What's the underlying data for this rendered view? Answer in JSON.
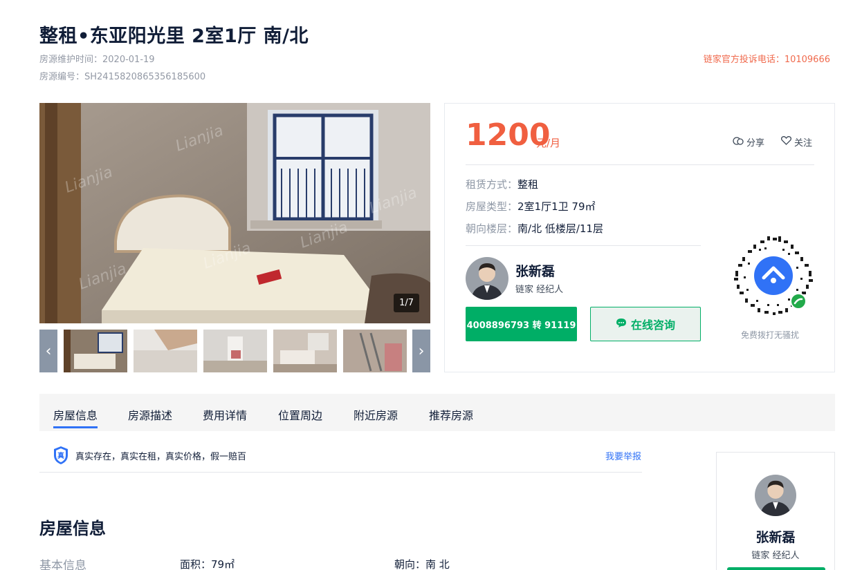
{
  "header": {
    "title": "整租•东亚阳光里 2室1厅 南/北",
    "maintain_time": "房源维护时间：2020-01-19",
    "listing_id": "房源编号：SH2415820865356185600",
    "complaint_hotline": "链家官方投诉电话：10109666"
  },
  "gallery": {
    "counter": "1/7",
    "watermark": "Lianjia"
  },
  "price_panel": {
    "price": "1200",
    "unit": "元/月",
    "share_label": "分享",
    "follow_label": "关注",
    "rows": [
      {
        "label": "租赁方式：",
        "value": "整租"
      },
      {
        "label": "房屋类型：",
        "value": "2室1厅1卫 79㎡"
      },
      {
        "label": "朝向楼层：",
        "value": "南/北 低楼层/11层"
      }
    ],
    "agent": {
      "name": "张新磊",
      "role": "链家 经纪人"
    },
    "phone_button": "4008896793 转 91119",
    "consult_button": "在线咨询",
    "qr_caption": "免费拨打无骚扰"
  },
  "tabs": [
    {
      "label": "房屋信息"
    },
    {
      "label": "房源描述"
    },
    {
      "label": "费用详情"
    },
    {
      "label": "位置周边"
    },
    {
      "label": "附近房源"
    },
    {
      "label": "推荐房源"
    }
  ],
  "guarantee": {
    "badge": "真",
    "text": "真实存在，真实在租，真实价格，假一赔百",
    "report_link": "我要举报"
  },
  "house_info": {
    "section_title": "房屋信息",
    "basic_label": "基本信息",
    "area": "面积：79㎡",
    "orientation": "朝向：南 北"
  },
  "side_agent": {
    "name": "张新磊",
    "role": "链家 经纪人"
  },
  "colors": {
    "price": "#f05f40",
    "green": "#00ae66",
    "blue": "#3072f6"
  }
}
